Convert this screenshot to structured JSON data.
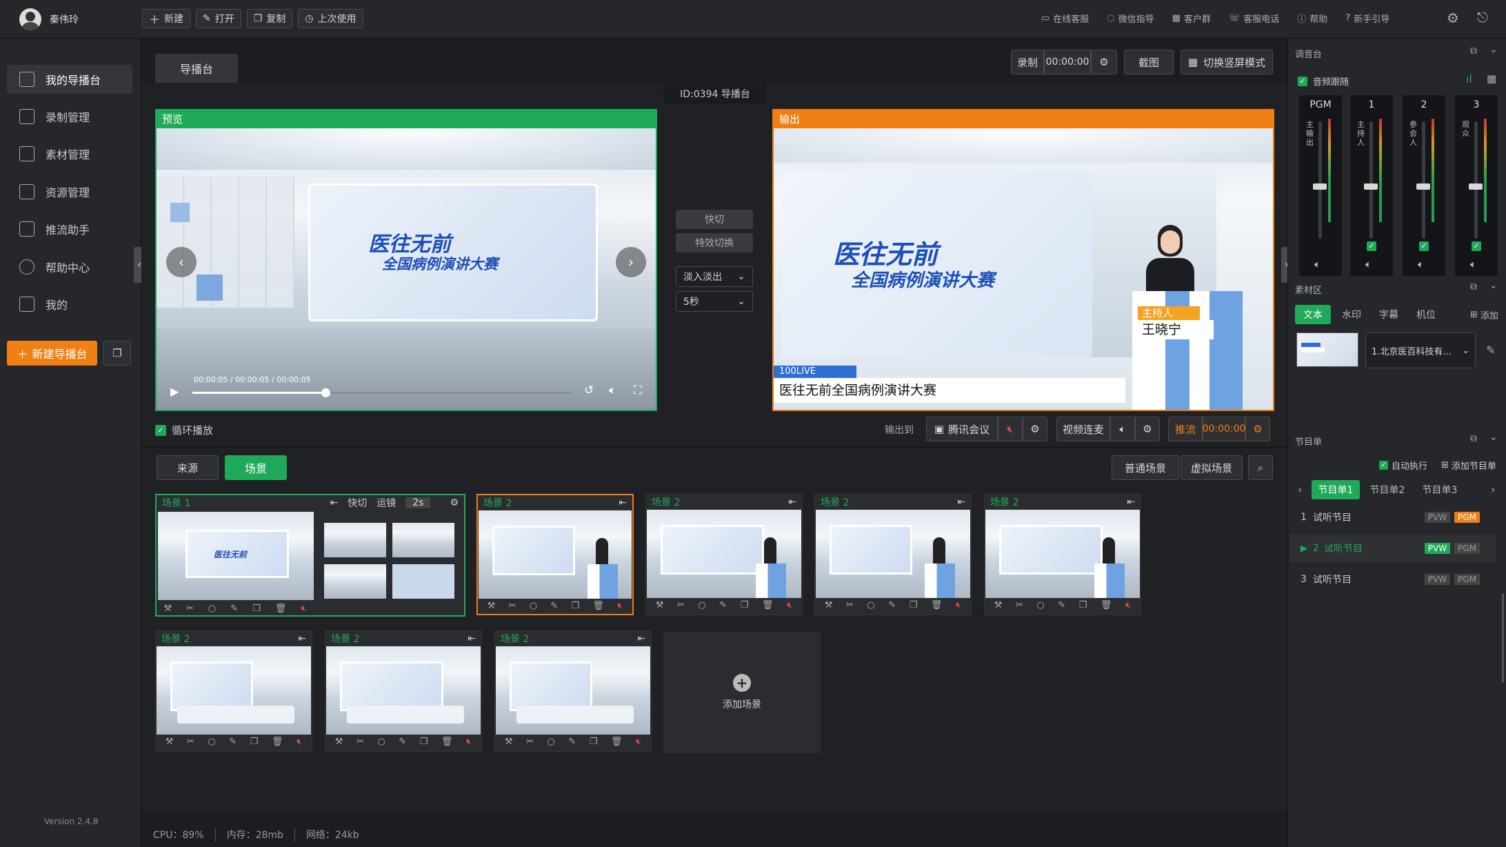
{
  "topbar": {
    "user_name": "秦伟玲",
    "buttons": [
      {
        "label": "新建",
        "icon": "plus-icon"
      },
      {
        "label": "打开",
        "icon": "edit-icon"
      },
      {
        "label": "复制",
        "icon": "copy-icon"
      },
      {
        "label": "上次使用",
        "icon": "clock-icon"
      }
    ],
    "links": [
      {
        "label": "在线客服",
        "icon": "chat-icon"
      },
      {
        "label": "微信指导",
        "icon": "wechat-icon"
      },
      {
        "label": "客户群",
        "icon": "group-icon"
      },
      {
        "label": "客服电话",
        "icon": "phone-icon"
      },
      {
        "label": "帮助",
        "icon": "info-icon"
      },
      {
        "label": "新手引导",
        "icon": "question-icon"
      }
    ]
  },
  "sidebar": {
    "items": [
      {
        "label": "我的导播台",
        "icon": "director-icon",
        "active": true
      },
      {
        "label": "录制管理",
        "icon": "record-icon"
      },
      {
        "label": "素材管理",
        "icon": "material-icon"
      },
      {
        "label": "资源管理",
        "icon": "folder-icon"
      },
      {
        "label": "推流助手",
        "icon": "stream-icon"
      },
      {
        "label": "帮助中心",
        "icon": "help-icon"
      },
      {
        "label": "我的",
        "icon": "user-icon"
      }
    ],
    "new_button": "新建导播台",
    "version": "Version 2.4.8"
  },
  "main": {
    "tab": "导播台",
    "id_label": "ID:0394 导播台",
    "record_label": "录制",
    "record_time": "00:00:00",
    "screenshot_label": "截图",
    "portrait_label": "切换竖屏模式",
    "preview_label": "预览",
    "output_label": "输出",
    "preview_title_1": "医往无前",
    "preview_title_2": "全国病例演讲大赛",
    "preview_time": "00:00:05 / 00:00:05 / 00:00:05",
    "progress": 0.35,
    "quick_cut": "快切",
    "effect_switch": "特效切换",
    "transition": "淡入淡出",
    "duration": "5秒",
    "loop_label": "循环播放",
    "output_to": "输出到",
    "tencent_label": "腾讯会议",
    "video_call_label": "视频连麦",
    "push_label": "推流",
    "push_time": "00:00:00",
    "host_tag": "主持人",
    "host_name": "王晓宁",
    "live_tag": "100LIVE",
    "caption": "医往无前全国病例演讲大赛"
  },
  "scenes_bar": {
    "source_tab": "来源",
    "scene_tab": "场景",
    "normal_scene": "普通场景",
    "virtual_scene": "虚拟场景"
  },
  "scene_group": {
    "title": "场景 1",
    "mode1": "快切",
    "mode2": "运镜",
    "duration": "2s"
  },
  "scenes": [
    {
      "title": "场景 2"
    },
    {
      "title": "场景 2"
    },
    {
      "title": "场景 2"
    },
    {
      "title": "场景 2"
    },
    {
      "title": "场景 2"
    },
    {
      "title": "场景 2"
    },
    {
      "title": "场景 2"
    }
  ],
  "add_scene": "添加场景",
  "status": {
    "cpu": "CPU：89%",
    "mem": "内存：28mb",
    "net": "网络：24kb"
  },
  "right": {
    "mixer_title": "调音台",
    "audio_follow": "音频跟随",
    "channels": [
      {
        "label": "PGM",
        "name": "主输出",
        "level": 0.45
      },
      {
        "label": "1",
        "name": "主持人",
        "level": 0.45
      },
      {
        "label": "2",
        "name": "参会人",
        "level": 0.45
      },
      {
        "label": "3",
        "name": "观众",
        "level": 0.45
      }
    ],
    "material_title": "素材区",
    "material_tabs": [
      "文本",
      "水印",
      "字幕",
      "机位"
    ],
    "add_label": "添加",
    "material_select": "1.北京医百科技有...",
    "program_title": "节目单",
    "auto_exec": "自动执行",
    "add_program": "添加节目单",
    "program_tabs": [
      "节目单1",
      "节目单2",
      "节目单3"
    ],
    "programs": [
      {
        "num": "1",
        "name": "试听节目",
        "pvw": "PVW",
        "pgm": "PGM"
      },
      {
        "num": "2",
        "name": "试听节目",
        "pvw": "PVW",
        "pgm": "PGM"
      },
      {
        "num": "3",
        "name": "试听节目",
        "pvw": "PVW",
        "pgm": "PGM"
      }
    ]
  }
}
